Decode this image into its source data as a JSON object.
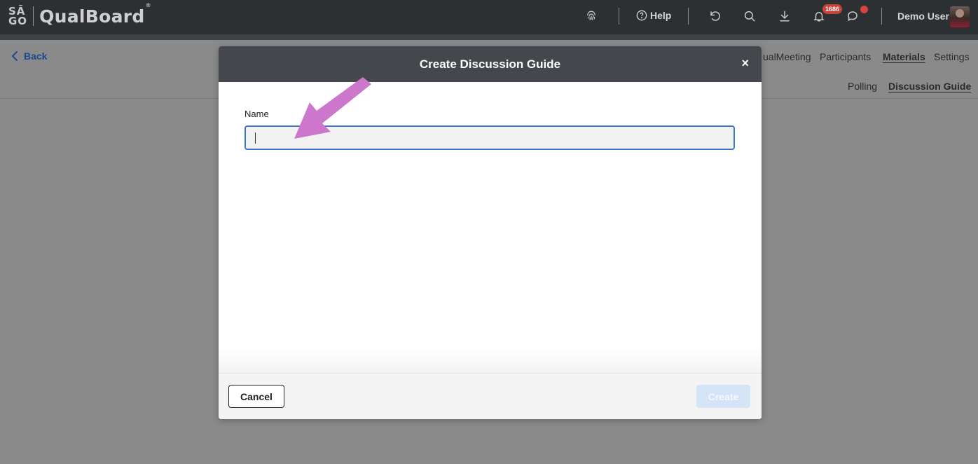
{
  "header": {
    "logo_mark_top": "SĀ",
    "logo_mark_bottom": "GO",
    "logo_text": "QualBoard",
    "logo_reg": "®",
    "help_label": "Help",
    "notification_count": "1686",
    "user_name": "Demo User"
  },
  "nav": {
    "back_label": "Back",
    "tabs": [
      {
        "label": "ualMeeting"
      },
      {
        "label": "Participants"
      },
      {
        "label": "Materials",
        "active": true
      },
      {
        "label": "Settings"
      }
    ],
    "subtabs": [
      {
        "label": "Polling"
      },
      {
        "label": "Discussion Guide",
        "active": true
      }
    ]
  },
  "modal": {
    "title": "Create Discussion Guide",
    "close_label": "×",
    "name_label": "Name",
    "name_value": "",
    "cancel_label": "Cancel",
    "create_label": "Create"
  },
  "colors": {
    "topbar": "#2d3033",
    "modal_header": "#44484c",
    "accent_blue": "#3f78c4",
    "link_blue": "#1f4a8f",
    "annotation_arrow": "#cc77cc",
    "badge_red": "#c9423a"
  }
}
